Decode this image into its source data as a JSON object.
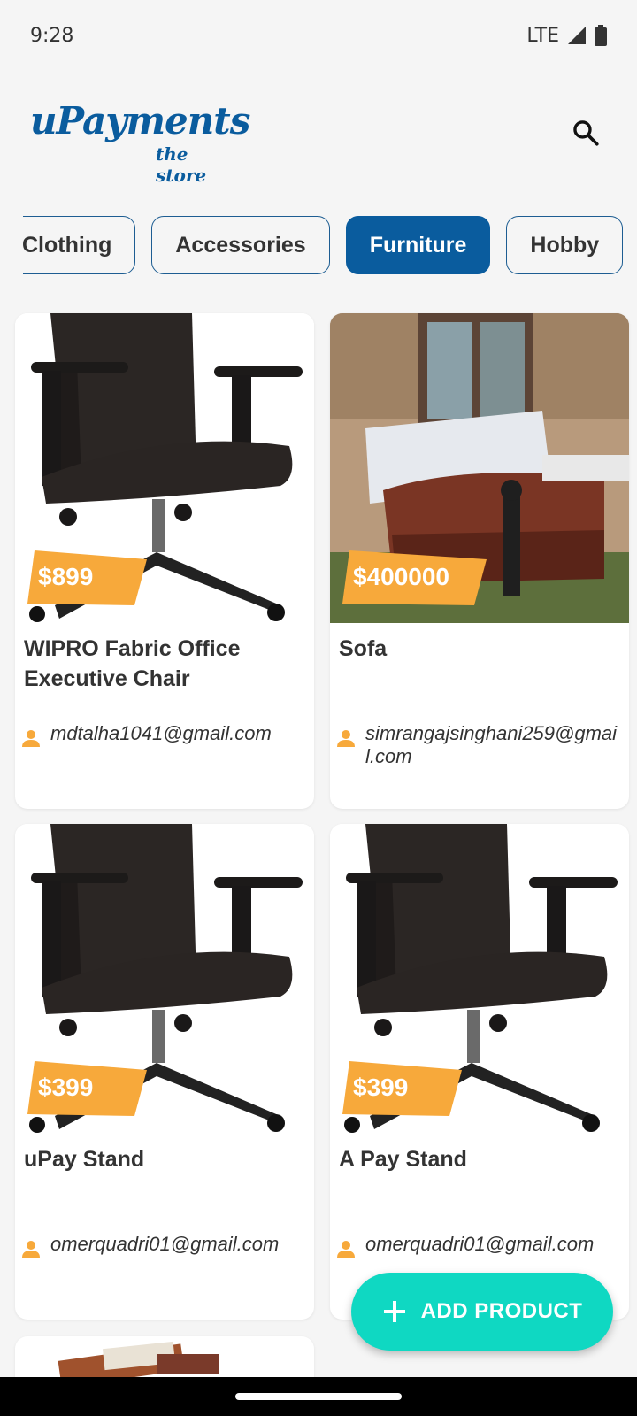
{
  "status_bar": {
    "time": "9:28",
    "network": "LTE"
  },
  "header": {
    "logo_main": "uPayments",
    "logo_sub": "the store",
    "search_icon": "search-icon"
  },
  "categories": [
    {
      "label": "Clothing",
      "active": false
    },
    {
      "label": "Accessories",
      "active": false
    },
    {
      "label": "Furniture",
      "active": true
    },
    {
      "label": "Hobby",
      "active": false
    }
  ],
  "products": [
    {
      "title": "WIPRO Fabric Office Executive Chair",
      "price": "$899",
      "email": "mdtalha1041@gmail.com",
      "image": "office-chair"
    },
    {
      "title": "Sofa",
      "price": "$400000",
      "email": "simrangajsinghani259@gmail.com",
      "image": "sofa-mattress"
    },
    {
      "title": "uPay Stand",
      "price": "$399",
      "email": "omerquadri01@gmail.com",
      "image": "office-chair"
    },
    {
      "title": "A Pay Stand",
      "price": "$399",
      "email": "omerquadri01@gmail.com",
      "image": "office-chair"
    }
  ],
  "fab": {
    "label": "ADD PRODUCT",
    "icon": "plus-icon"
  },
  "colors": {
    "brand": "#0a5c9e",
    "price_tag": "#f7a93b",
    "fab": "#0fd8c2",
    "user_icon": "#f7a93b"
  }
}
